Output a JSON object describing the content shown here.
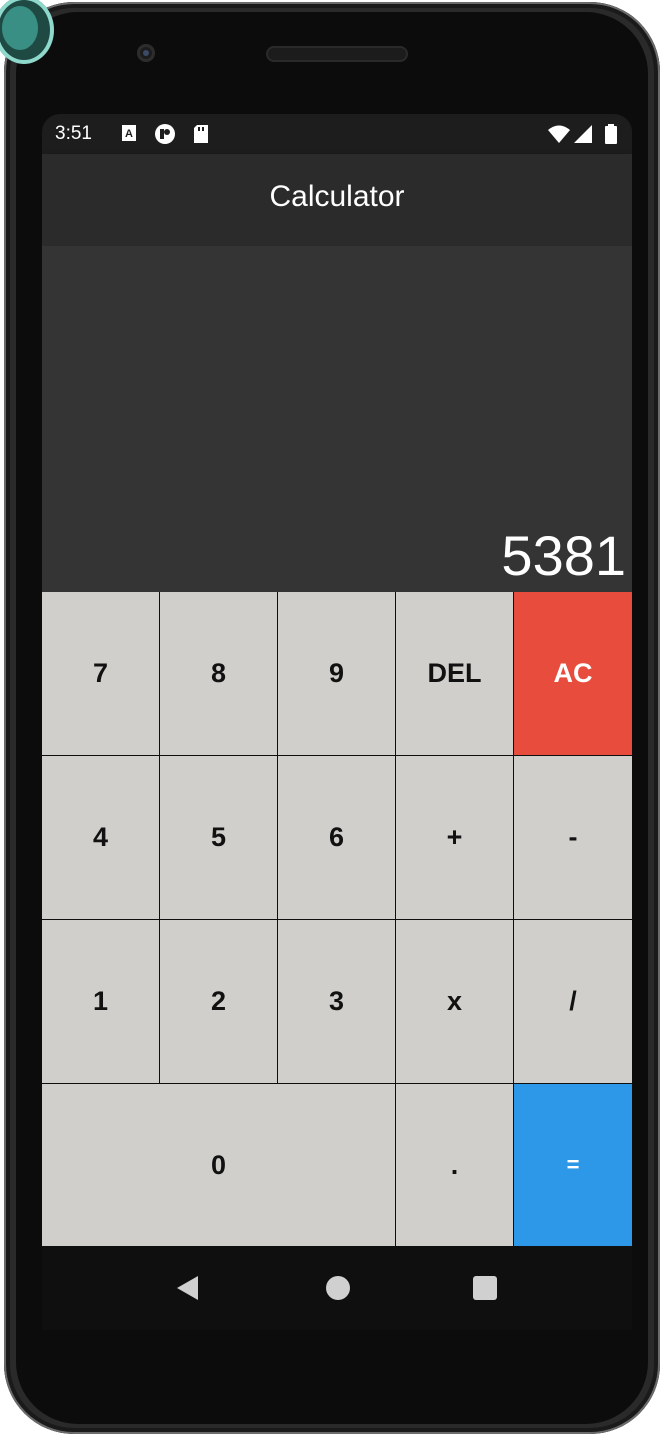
{
  "status_bar": {
    "time": "3:51",
    "left_icons": [
      "text-format-icon",
      "app-notification-icon",
      "sd-card-icon"
    ],
    "right_icons": [
      "wifi-icon",
      "cell-signal-icon",
      "battery-icon"
    ]
  },
  "app_bar": {
    "title": "Calculator"
  },
  "display": {
    "value": "5381"
  },
  "keypad": {
    "keys": [
      {
        "label": "7"
      },
      {
        "label": "8"
      },
      {
        "label": "9"
      },
      {
        "label": "DEL"
      },
      {
        "label": "AC"
      },
      {
        "label": "4"
      },
      {
        "label": "5"
      },
      {
        "label": "6"
      },
      {
        "label": "+"
      },
      {
        "label": "-"
      },
      {
        "label": "1"
      },
      {
        "label": "2"
      },
      {
        "label": "3"
      },
      {
        "label": "x"
      },
      {
        "label": "/"
      },
      {
        "label": "0"
      },
      {
        "label": "."
      },
      {
        "label": "="
      }
    ]
  },
  "colors": {
    "key_default": "#d0cfcb",
    "key_clear": "#e84c3d",
    "key_equals": "#2d97e8",
    "display_bg": "#343434",
    "app_bar_bg": "#2b2b2b"
  },
  "nav_bar": {
    "icons": [
      "back-icon",
      "home-icon",
      "recents-icon"
    ]
  }
}
